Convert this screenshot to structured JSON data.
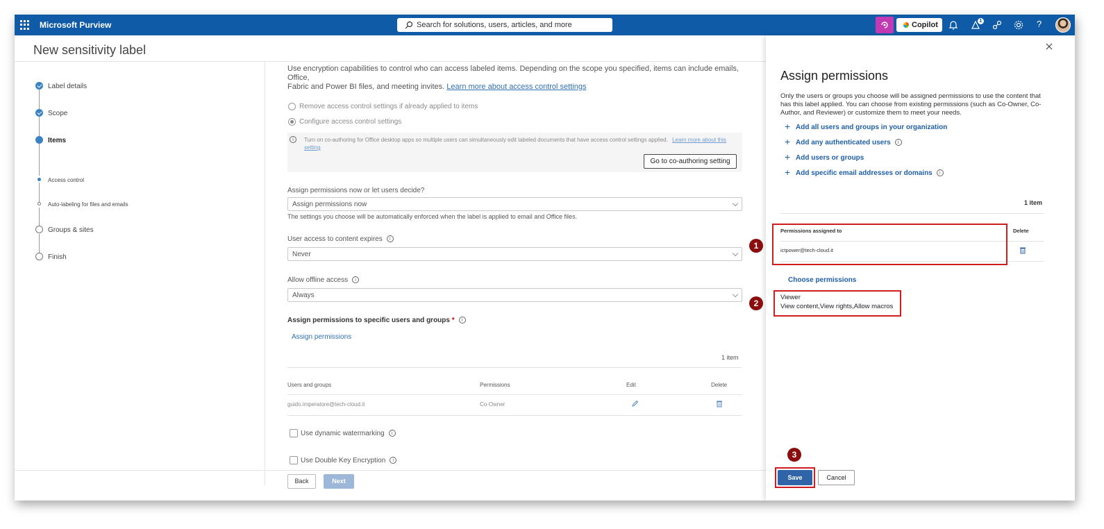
{
  "app": {
    "brand": "Microsoft Purview"
  },
  "search": {
    "placeholder": "Search for solutions, users, articles, and more"
  },
  "topbar": {
    "copilot_label": "Copilot",
    "notif_count": "1",
    "help": "?"
  },
  "page": {
    "title": "New sensitivity label"
  },
  "steps": [
    {
      "label": "Label details",
      "state": "done"
    },
    {
      "label": "Scope",
      "state": "done"
    },
    {
      "label": "Items",
      "state": "current"
    },
    {
      "label": "Access control",
      "state": "sub-current"
    },
    {
      "label": "Auto-labeling for files and emails",
      "state": "sub"
    },
    {
      "label": "Groups & sites",
      "state": "todo"
    },
    {
      "label": "Finish",
      "state": "todo"
    }
  ],
  "main": {
    "intro_a": "Use encryption capabilities to control who can access labeled items. Depending on the scope you specified, items can include emails, Office,",
    "intro_b": "Fabric and Power BI files, and meeting invites.",
    "intro_link": "Learn more about access control settings",
    "radio_remove": "Remove access control settings if already applied to items",
    "radio_configure": "Configure access control settings",
    "info_text": "Turn on co-authoring for Office desktop apps so multiple users can simultaneously edit labeled documents that have access control settings applied.",
    "info_link_a": "Learn more about this",
    "info_link_b": "setting",
    "coauth_button": "Go to co-authoring setting",
    "assign_q": "Assign permissions now or let users decide?",
    "assign_value": "Assign permissions now",
    "assign_hint": "The settings you choose will be automatically enforced when the label is applied to email and Office files.",
    "expires_label": "User access to content expires",
    "expires_value": "Never",
    "offline_label": "Allow offline access",
    "offline_value": "Always",
    "specific_label": "Assign permissions to specific users and groups",
    "required_mark": "*",
    "assign_link": "Assign permissions",
    "item_count": "1 item",
    "table": {
      "headers": [
        "Users and groups",
        "Permissions",
        "Edit",
        "Delete"
      ],
      "rows": [
        {
          "user": "guido.imperatore@tech-cloud.it",
          "perm": "Co-Owner"
        }
      ]
    },
    "dyn_watermark": "Use dynamic watermarking",
    "double_key": "Use Double Key Encryption",
    "back": "Back",
    "next": "Next"
  },
  "panel": {
    "title": "Assign permissions",
    "desc": "Only the users or groups you choose will be assigned permissions to use the content that has this label applied. You can choose from existing permissions (such as Co-Owner, Co-Author, and Reviewer) or customize them to meet your needs.",
    "add_all": "Add all users and groups in your organization",
    "add_auth": "Add any authenticated users",
    "add_users": "Add users or groups",
    "add_email": "Add specific email addresses or domains",
    "count": "1 item",
    "col_assigned": "Permissions assigned to",
    "col_delete": "Delete",
    "assigned_user": "ictpower@tech-cloud.it",
    "choose": "Choose permissions",
    "perm_name": "Viewer",
    "perm_detail": "View content,View rights,Allow macros",
    "save": "Save",
    "cancel": "Cancel"
  },
  "callouts": [
    "1",
    "2",
    "3"
  ],
  "colors": {
    "accent": "#0f5ba7",
    "callout_red": "#d01c1c",
    "callout_num": "#8b0d0d",
    "link": "#2f6fb5"
  }
}
